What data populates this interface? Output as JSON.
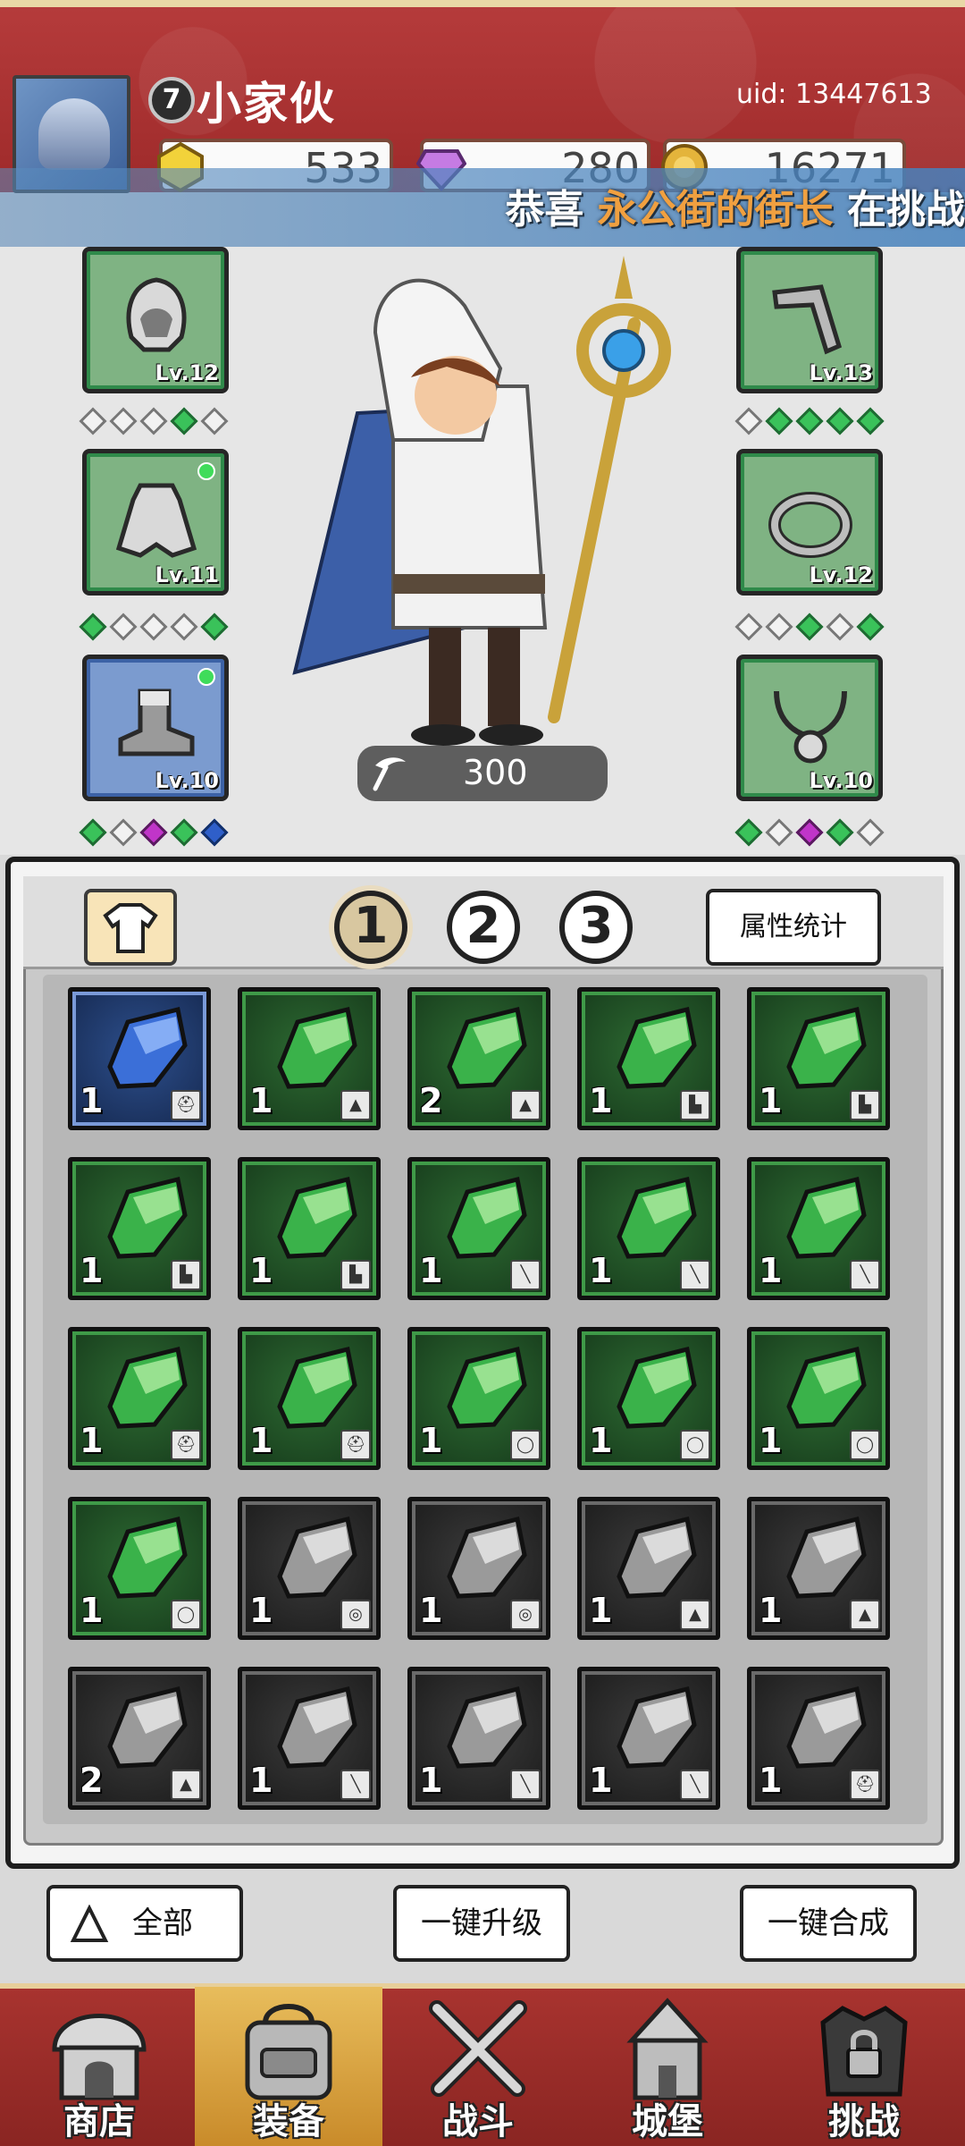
{
  "player": {
    "level": "7",
    "name": "小家伙",
    "uid": "uid: 13447613"
  },
  "currencies": [
    {
      "name": "gold-crystal",
      "value": "533",
      "color": "#f2d23a"
    },
    {
      "name": "purple-diamond",
      "value": "280",
      "color": "#c57be3"
    },
    {
      "name": "coin",
      "value": "16271",
      "color": "#e4b43b"
    }
  ],
  "banner": {
    "prefix": "恭喜",
    "highlight": "永公街的街长",
    "suffix": "在挑战"
  },
  "equipment": {
    "left": [
      {
        "slot": "hood",
        "level": "Lv.12",
        "style": "green",
        "gems": [
          "e",
          "e",
          "e",
          "g",
          "e"
        ],
        "new_dot": false
      },
      {
        "slot": "cloak",
        "level": "Lv.11",
        "style": "green",
        "gems": [
          "g",
          "e",
          "e",
          "e",
          "g"
        ],
        "new_dot": true
      },
      {
        "slot": "boots",
        "level": "Lv.10",
        "style": "blue",
        "gems": [
          "g",
          "e",
          "p",
          "g",
          "b"
        ],
        "new_dot": true
      }
    ],
    "right": [
      {
        "slot": "weapon",
        "level": "Lv.13",
        "style": "green",
        "gems": [
          "e",
          "g",
          "g",
          "g",
          "g"
        ],
        "new_dot": false
      },
      {
        "slot": "ring",
        "level": "Lv.12",
        "style": "green",
        "gems": [
          "e",
          "e",
          "g",
          "e",
          "g"
        ],
        "new_dot": false
      },
      {
        "slot": "necklace",
        "level": "Lv.10",
        "style": "green",
        "gems": [
          "g",
          "e",
          "p",
          "g",
          "e"
        ],
        "new_dot": false
      }
    ],
    "power": "300"
  },
  "inventory": {
    "pages": [
      "1",
      "2",
      "3"
    ],
    "active_page": 0,
    "stats_label": "属性统计",
    "items": [
      {
        "rarity": "blue",
        "count": "1",
        "tag": "helm"
      },
      {
        "rarity": "green",
        "count": "1",
        "tag": "cloak"
      },
      {
        "rarity": "green",
        "count": "2",
        "tag": "cloak"
      },
      {
        "rarity": "green",
        "count": "1",
        "tag": "boots"
      },
      {
        "rarity": "green",
        "count": "1",
        "tag": "boots"
      },
      {
        "rarity": "green",
        "count": "1",
        "tag": "boots"
      },
      {
        "rarity": "green",
        "count": "1",
        "tag": "boots"
      },
      {
        "rarity": "green",
        "count": "1",
        "tag": "weapon"
      },
      {
        "rarity": "green",
        "count": "1",
        "tag": "weapon"
      },
      {
        "rarity": "green",
        "count": "1",
        "tag": "weapon"
      },
      {
        "rarity": "green",
        "count": "1",
        "tag": "helm"
      },
      {
        "rarity": "green",
        "count": "1",
        "tag": "helm"
      },
      {
        "rarity": "green",
        "count": "1",
        "tag": "necklace"
      },
      {
        "rarity": "green",
        "count": "1",
        "tag": "necklace"
      },
      {
        "rarity": "green",
        "count": "1",
        "tag": "necklace"
      },
      {
        "rarity": "green",
        "count": "1",
        "tag": "necklace"
      },
      {
        "rarity": "gray",
        "count": "1",
        "tag": "ring"
      },
      {
        "rarity": "gray",
        "count": "1",
        "tag": "ring"
      },
      {
        "rarity": "gray",
        "count": "1",
        "tag": "cloak"
      },
      {
        "rarity": "gray",
        "count": "1",
        "tag": "cloak"
      },
      {
        "rarity": "gray",
        "count": "2",
        "tag": "cloak"
      },
      {
        "rarity": "gray",
        "count": "1",
        "tag": "weapon"
      },
      {
        "rarity": "gray",
        "count": "1",
        "tag": "weapon"
      },
      {
        "rarity": "gray",
        "count": "1",
        "tag": "weapon"
      },
      {
        "rarity": "gray",
        "count": "1",
        "tag": "helm"
      }
    ]
  },
  "actions": {
    "filter_label": "全部",
    "upgrade_label": "一键升级",
    "merge_label": "一键合成"
  },
  "nav": [
    {
      "id": "shop",
      "label": "商店",
      "active": false
    },
    {
      "id": "equipment",
      "label": "装备",
      "active": true
    },
    {
      "id": "battle",
      "label": "战斗",
      "active": false
    },
    {
      "id": "castle",
      "label": "城堡",
      "active": false
    },
    {
      "id": "challenge",
      "label": "挑战",
      "active": false
    }
  ]
}
